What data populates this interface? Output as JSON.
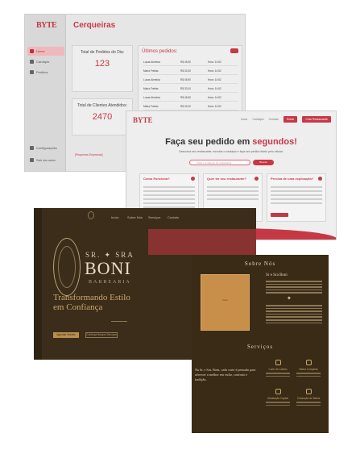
{
  "dashboard": {
    "logo": "BYTE",
    "title": "Cerqueiras",
    "nav": [
      {
        "label": "Home",
        "active": true
      },
      {
        "label": "Cardápio",
        "active": false
      },
      {
        "label": "Pedidos",
        "active": false
      }
    ],
    "bottom_nav": [
      {
        "label": "Configurações"
      },
      {
        "label": "Sair da conta"
      }
    ],
    "stats": [
      {
        "label": "Total de Pedidos do Dia:",
        "value": "123"
      },
      {
        "label": "Total de Clientes Atendidos:",
        "value": "2470"
      }
    ],
    "orders": {
      "title": "Últimos pedidos:",
      "rows": [
        {
          "name": "Lucas Almeida",
          "price": "R$ 45,90",
          "time": "Hora: 14:52"
        },
        {
          "name": "Maria Freitas",
          "price": "R$ 32,00",
          "time": "Hora: 14:52"
        },
        {
          "name": "Lucas Almeida",
          "price": "R$ 45,90",
          "time": "Hora: 14:52"
        },
        {
          "name": "Maria Freitas",
          "price": "R$ 32,00",
          "time": "Hora: 14:52"
        },
        {
          "name": "Lucas Almeida",
          "price": "R$ 45,90",
          "time": "Hora: 14:52"
        },
        {
          "name": "Maria Freitas",
          "price": "R$ 32,00",
          "time": "Hora: 14:52"
        }
      ]
    },
    "promo": "[Pequenas Empresas]"
  },
  "landing": {
    "logo": "BYTE",
    "links": [
      "Início",
      "Cardápio",
      "Contato"
    ],
    "login_label": "Entrar",
    "signup_label": "Criar Restaurante",
    "hero_prefix": "Faça seu pedido em ",
    "hero_highlight": "segundos!",
    "subtitle": "Descubra seu restaurante, escolha o cardápio e faça seu pedido direto pelo celular.",
    "search_placeholder": "Insira o endereço do restaurante",
    "search_button": "Buscar Restaurantes",
    "features": [
      {
        "title": "Como Funciona?",
        "button": ""
      },
      {
        "title": "Quer ter seu restaurante?",
        "button": "Criar Restaurante"
      },
      {
        "title": "Precisa de uma explicação?",
        "button": "Falar Conosco"
      }
    ]
  },
  "barber": {
    "nav": [
      "Início",
      "Sobre Nós",
      "Serviços",
      "Contato"
    ],
    "brand_top": "SR. ✦ SRA",
    "brand": "BONI",
    "brand_sub": "BARBEARIA",
    "tagline_1": "Transformando Estilo",
    "tagline_2": "em Confiança",
    "cta_primary": "Agendar Horário",
    "cta_secondary": "Conheça Nossos Serviços"
  },
  "about": {
    "title": "Sobre Nós",
    "subtitle": "Sr e Sra Boni",
    "photo_label": "Foto",
    "services_title": "Serviços",
    "services_desc": "Na Sr. e Sra. Boni, cada corte é pensado para oferecer o melhor em estilo, conforto e tradição.",
    "services": [
      "Corte de Cabelo",
      "Barba Completa",
      "Hidratação Capilar",
      "Coloração de Barba"
    ]
  },
  "colors": {
    "accent": "#c73845",
    "barber_bg": "#3c2d1a",
    "gold": "#c9a86b"
  }
}
